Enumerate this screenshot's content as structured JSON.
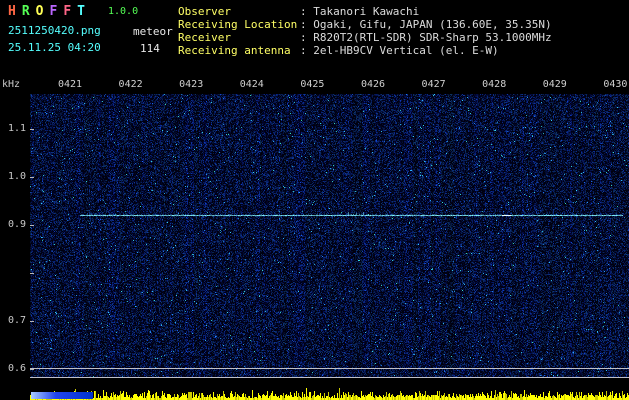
{
  "header": {
    "title_letters": [
      {
        "char": "H",
        "color": "#ff6644"
      },
      {
        "char": "R",
        "color": "#55ff55"
      },
      {
        "char": "O",
        "color": "#ffff55"
      },
      {
        "char": "F",
        "color": "#bb66ff"
      },
      {
        "char": "F",
        "color": "#ff6688"
      },
      {
        "char": "T",
        "color": "#55ffff"
      }
    ],
    "version": "1.0.0",
    "filename": "2511250420.png",
    "mode": "meteor",
    "datetime": "25.11.25 04:20",
    "count": "114",
    "info_rows": [
      {
        "label": "Observer",
        "value": ": Takanori Kawachi"
      },
      {
        "label": "Receiving Location",
        "value": ": Ogaki, Gifu, JAPAN (136.60E, 35.35N)"
      },
      {
        "label": "Receiver",
        "value": ": R820T2(RTL-SDR) SDR-Sharp 53.1000MHz"
      },
      {
        "label": "Receiving antenna",
        "value": ": 2el-HB9CV Vertical (el. E-W)"
      }
    ]
  },
  "plot": {
    "unit_label": "kHz",
    "time_labels": [
      "0421",
      "0422",
      "0423",
      "0424",
      "0425",
      "0426",
      "0427",
      "0428",
      "0429",
      "0430"
    ],
    "freq_labels": [
      "1.1",
      "1.0",
      "0.9",
      "0.7",
      "0.6"
    ]
  },
  "colors": {
    "signal_line": "#66ffff",
    "level_bars": "#ffff00",
    "level_bars_dim": "#cccc00",
    "label_yellow": "#ffff66",
    "value_text": "#dcdcdc",
    "cyan_text": "#55ffff",
    "axis_text": "#c8c8c8",
    "noise_background": "#000020"
  }
}
